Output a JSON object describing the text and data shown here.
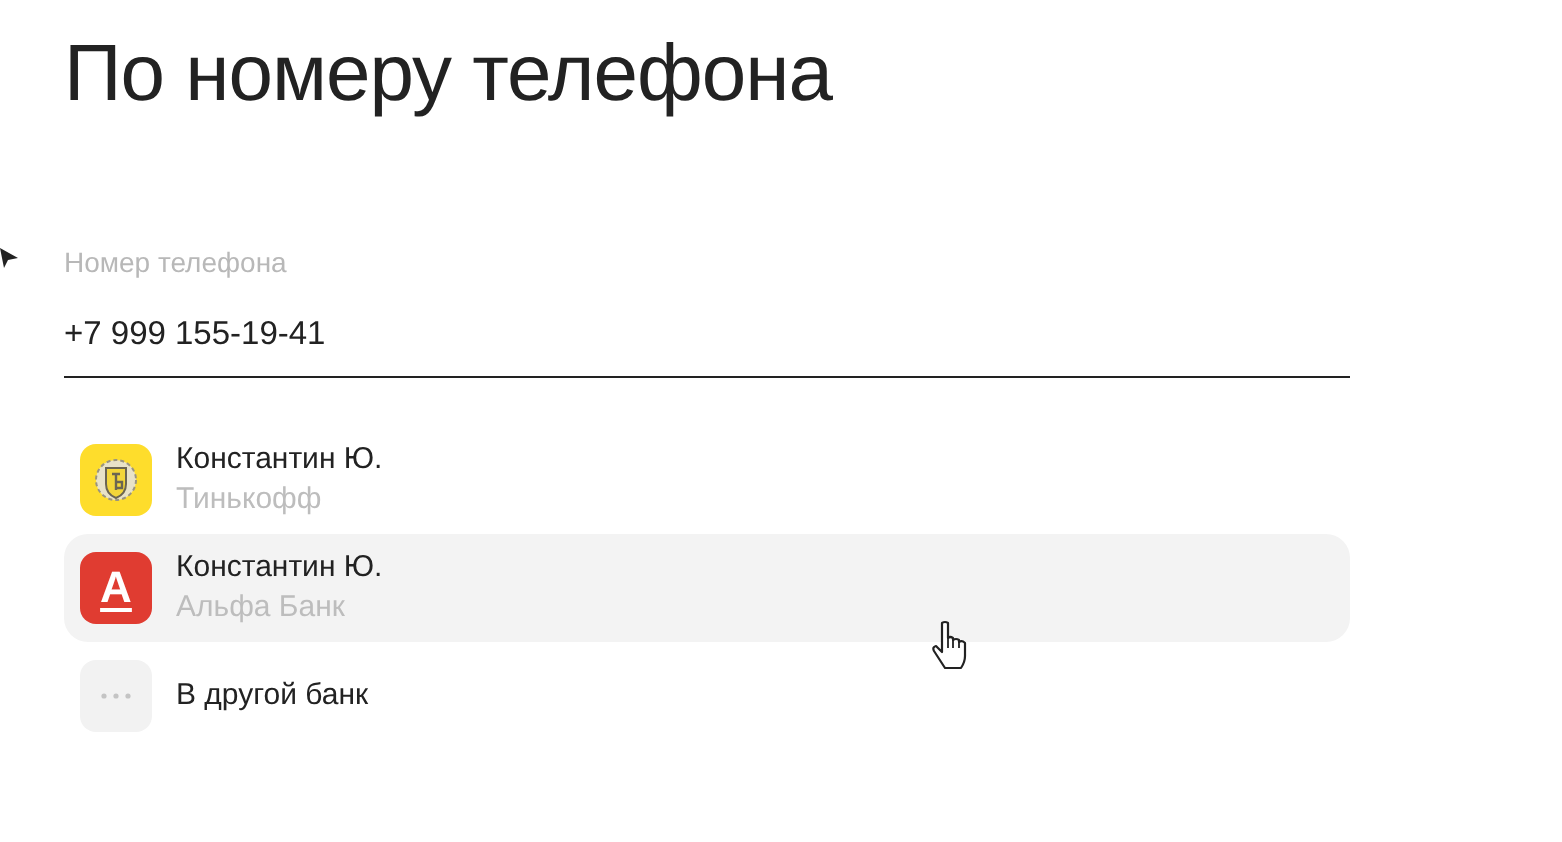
{
  "title": "По номеру телефона",
  "phone_field": {
    "label": "Номер телефона",
    "value": "+7 999 155-19-41"
  },
  "recipients": [
    {
      "kind": "tinkoff",
      "name": "Константин Ю.",
      "bank": "Тинькофф",
      "highlighted": false
    },
    {
      "kind": "alfa",
      "logo_letter": "А",
      "name": "Константин Ю.",
      "bank": "Альфа Банк",
      "highlighted": true
    },
    {
      "kind": "other",
      "name": "В другой банк",
      "highlighted": false
    }
  ]
}
